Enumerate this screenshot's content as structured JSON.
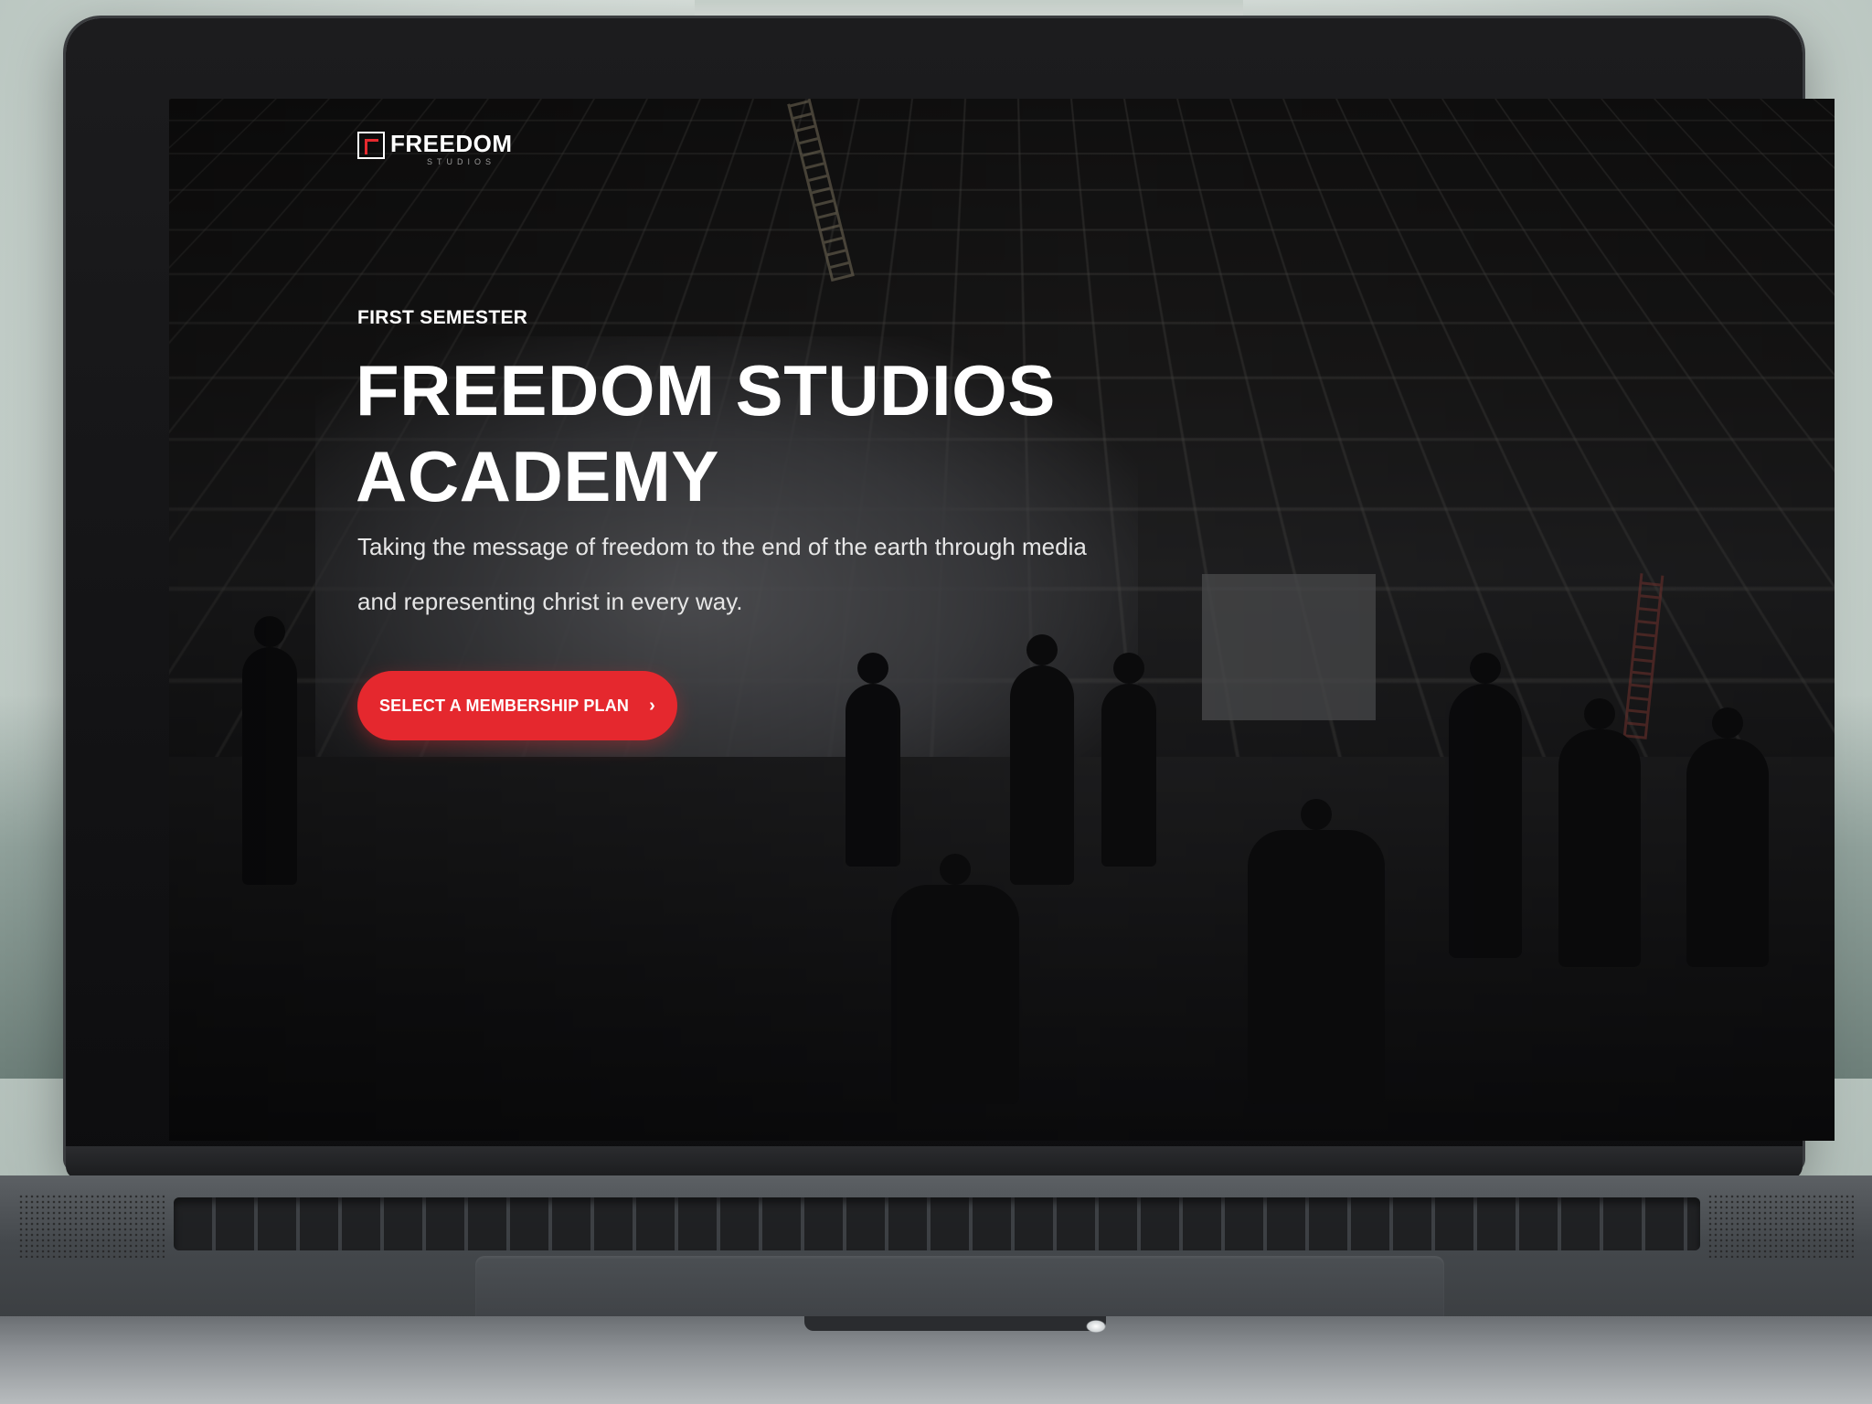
{
  "site": {
    "logo": {
      "name": "FREEDOM",
      "subtitle": "STUDIOS"
    }
  },
  "hero": {
    "eyebrow": "FIRST SEMESTER",
    "title_line1": "FREEDOM STUDIOS",
    "title_line2": "ACADEMY",
    "description_line1": "Taking the message of freedom to the end of the earth through media",
    "description_line2": "and representing christ in every way.",
    "cta_label": "SELECT A MEMBERSHIP PLAN",
    "cta_icon": "chevron-right-icon"
  },
  "colors": {
    "accent": "#e5282e",
    "text": "#ffffff",
    "background": "#0b0b0c"
  }
}
